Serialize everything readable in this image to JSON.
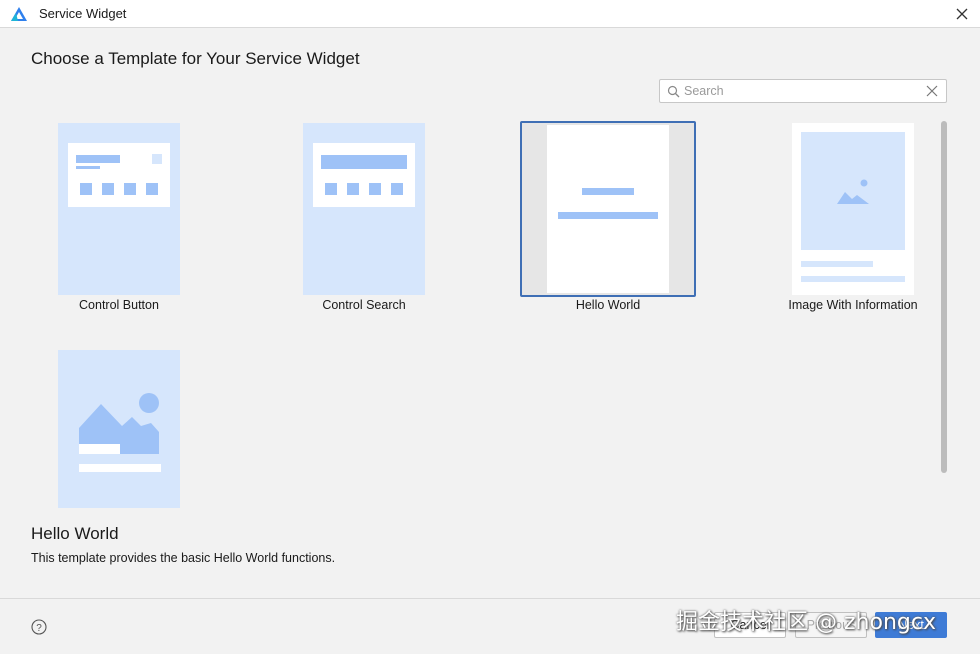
{
  "window": {
    "title": "Service Widget",
    "logo_icon": "app-logo-icon",
    "close_icon": "close-icon"
  },
  "heading": "Choose a Template for Your Service Widget",
  "search": {
    "placeholder": "Search",
    "value": "",
    "icon": "search-icon",
    "clear_icon": "clear-icon"
  },
  "templates": [
    {
      "label": "Control Button",
      "selected": false
    },
    {
      "label": "Control Search",
      "selected": false
    },
    {
      "label": "Hello World",
      "selected": true
    },
    {
      "label": "Image With Information",
      "selected": false
    },
    {
      "label": "",
      "selected": false
    }
  ],
  "details": {
    "title": "Hello World",
    "description": "This template provides the basic Hello World functions."
  },
  "footer": {
    "help_icon": "help-icon",
    "cancel_label": "Cancel",
    "previous_label": "Previous",
    "next_label": "Next"
  },
  "watermark": "掘金技术社区 @ zhongcx",
  "colors": {
    "accent": "#3e7bd6",
    "thumb_bg": "#d6e6fc",
    "thumb_shape": "#9ec2f7",
    "selection_border": "#3f6fb5"
  }
}
